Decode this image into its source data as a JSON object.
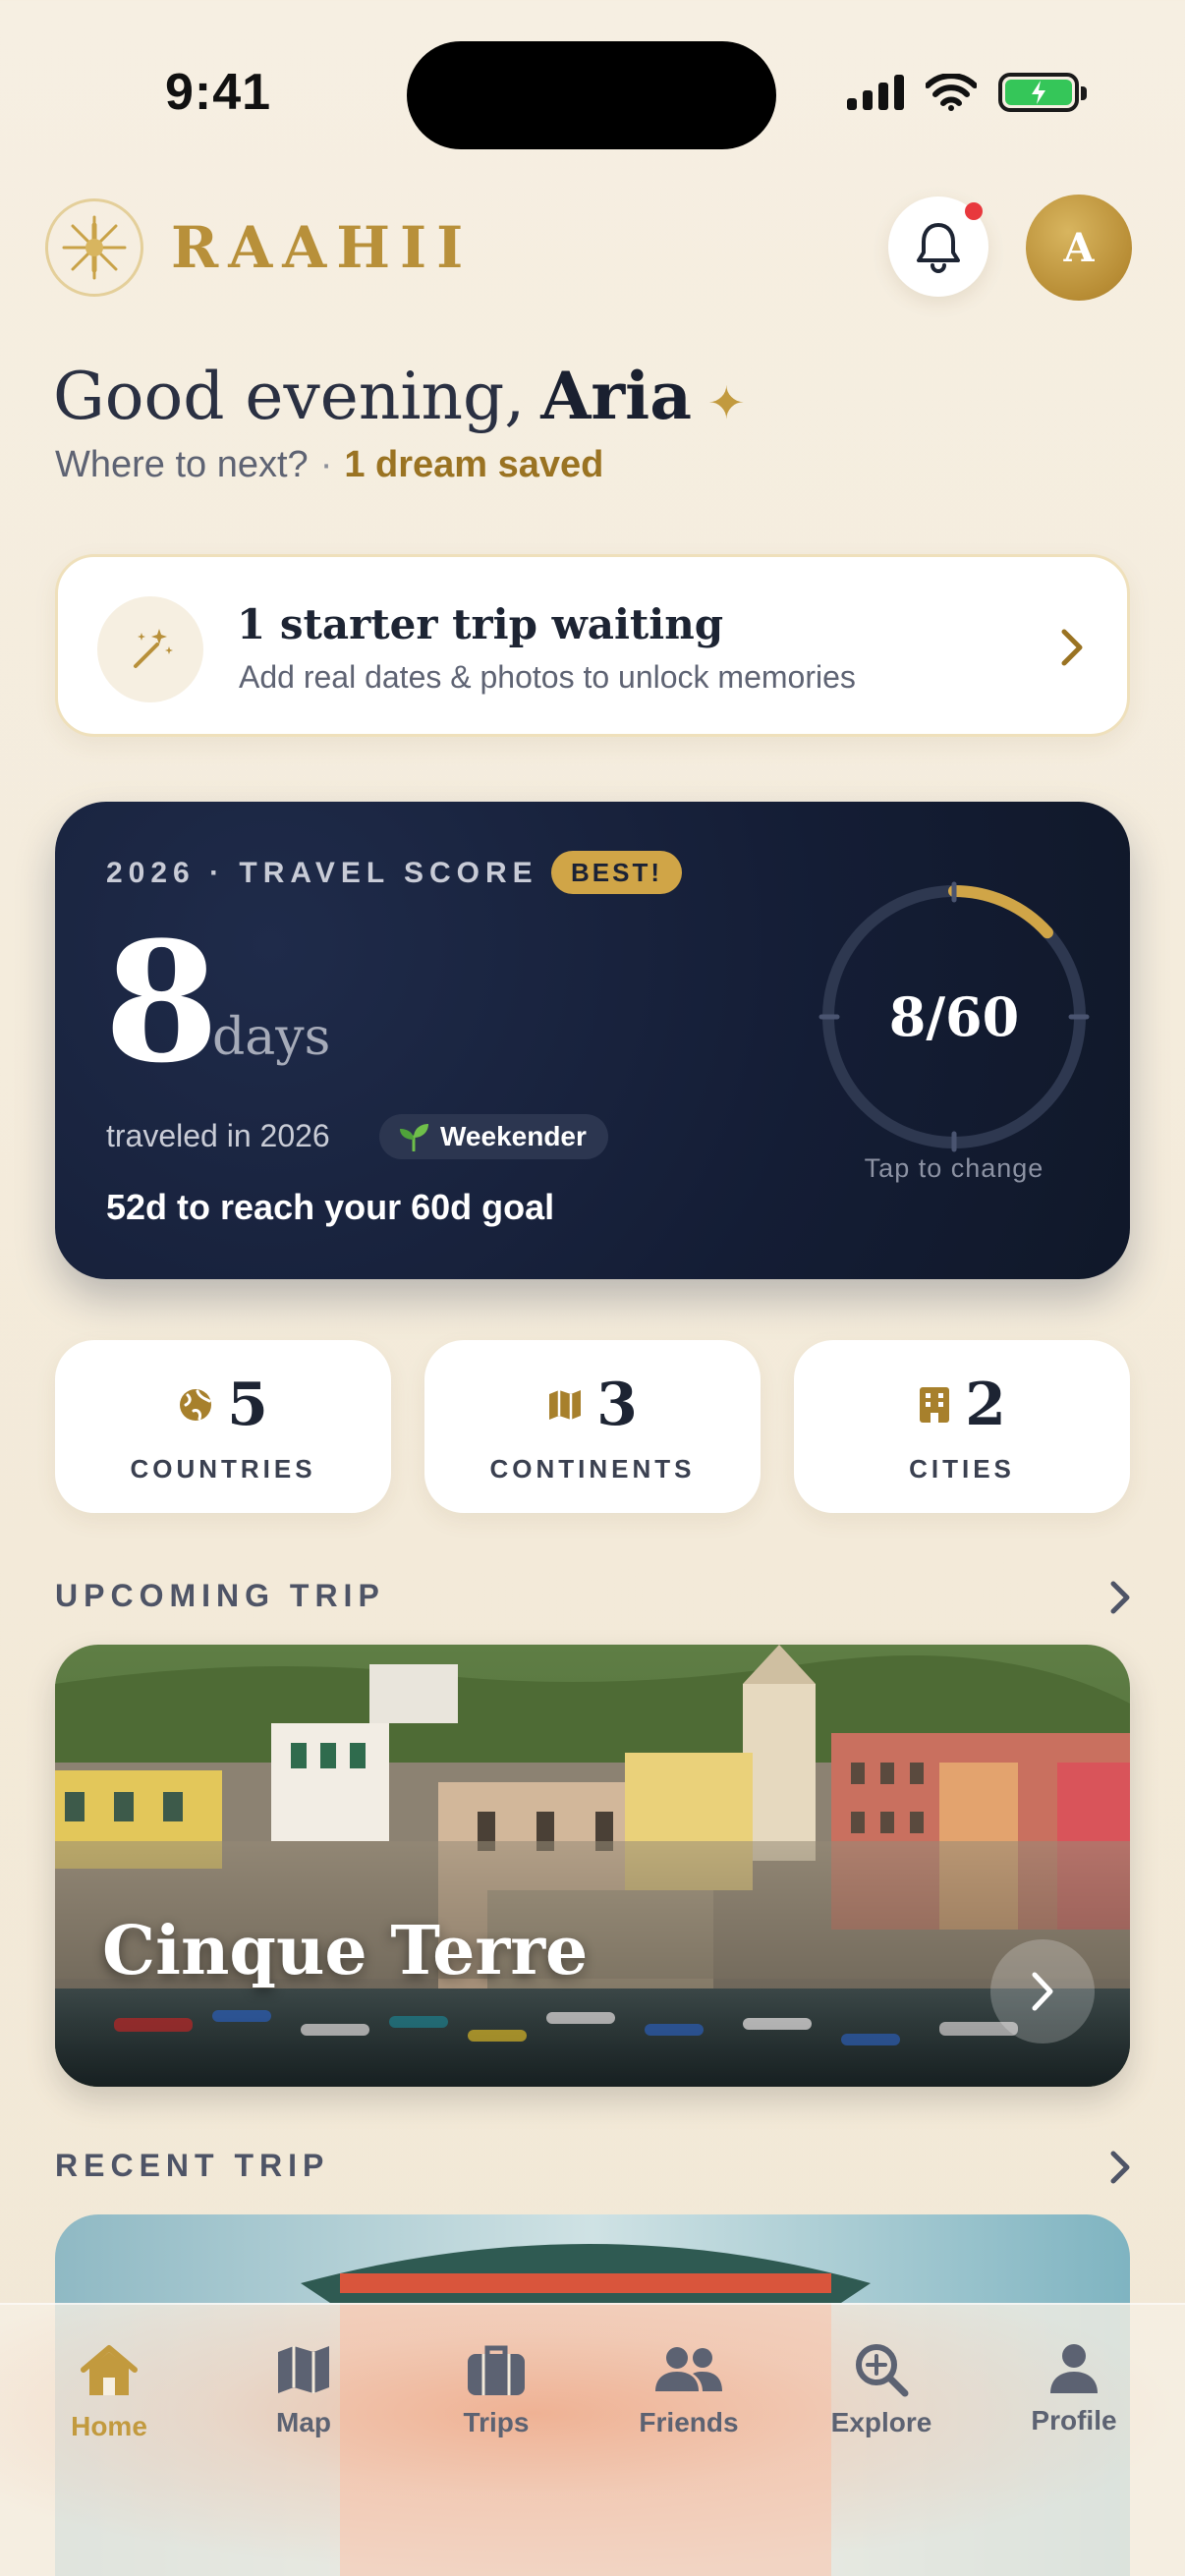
{
  "status": {
    "time": "9:41"
  },
  "header": {
    "brand": "RAAHII",
    "avatar_initial": "A"
  },
  "greeting": {
    "salutation": "Good evening,",
    "name": "Aria",
    "prompt": "Where to next?",
    "separator": "·",
    "dreams": "1 dream saved"
  },
  "starter": {
    "title": "1 starter trip waiting",
    "subtitle": "Add real dates & photos to unlock memories"
  },
  "score": {
    "label": "2026 · TRAVEL SCORE",
    "badge": "BEST!",
    "days": "8",
    "unit": "days",
    "traveled": "traveled in 2026",
    "tier": "Weekender",
    "goal_text": "52d to reach your 60d goal",
    "ring_value": "8/60",
    "ring_progress": 0.133,
    "ring_caption": "Tap to change"
  },
  "stats": [
    {
      "icon": "globe-icon",
      "value": "5",
      "label": "COUNTRIES"
    },
    {
      "icon": "map-icon",
      "value": "3",
      "label": "CONTINENTS"
    },
    {
      "icon": "building-icon",
      "value": "2",
      "label": "CITIES"
    }
  ],
  "upcoming": {
    "section": "UPCOMING TRIP",
    "title": "Cinque Terre"
  },
  "recent": {
    "section": "RECENT TRIP"
  },
  "tabs": [
    {
      "label": "Home",
      "icon": "home-icon",
      "active": true
    },
    {
      "label": "Map",
      "icon": "map-icon",
      "active": false
    },
    {
      "label": "Trips",
      "icon": "suitcase-icon",
      "active": false
    },
    {
      "label": "Friends",
      "icon": "friends-icon",
      "active": false
    },
    {
      "label": "Explore",
      "icon": "explore-icon",
      "active": false
    },
    {
      "label": "Profile",
      "icon": "profile-icon",
      "active": false
    }
  ],
  "colors": {
    "accent": "#c29a3e",
    "navy": "#141d35",
    "notification": "#e8383d"
  }
}
